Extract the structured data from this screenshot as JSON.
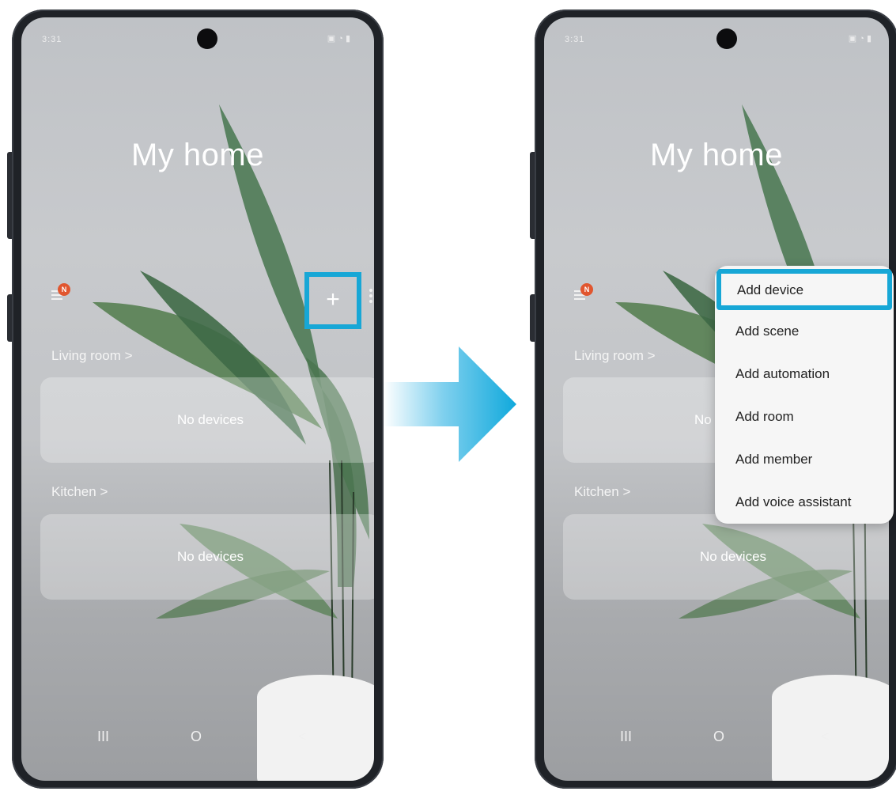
{
  "left_screen": {
    "status_time": "3:31",
    "title": "My home",
    "notification_badge": "N",
    "add_button_label": "+",
    "rooms": [
      {
        "name": "Living room",
        "empty_text": "No devices"
      },
      {
        "name": "Kitchen",
        "empty_text": "No devices"
      }
    ],
    "nav": {
      "recents": "III",
      "home": "O",
      "back": "<"
    }
  },
  "right_screen": {
    "status_time": "3:31",
    "title": "My home",
    "notification_badge": "N",
    "rooms": [
      {
        "name": "Living room",
        "empty_text": "No d"
      },
      {
        "name": "Kitchen",
        "empty_text": "No devices"
      }
    ],
    "nav": {
      "recents": "III",
      "home": "O",
      "back": "<"
    },
    "menu": {
      "items": [
        {
          "label": "Add device"
        },
        {
          "label": "Add scene"
        },
        {
          "label": "Add automation"
        },
        {
          "label": "Add room"
        },
        {
          "label": "Add member"
        },
        {
          "label": "Add voice assistant"
        }
      ]
    }
  },
  "colors": {
    "highlight": "#17a7d6",
    "badge": "#e1562f",
    "arrow": "#10a9dc",
    "leaf": "#4e7a55"
  },
  "icons": [
    "menu-icon",
    "more-options-icon",
    "add-icon",
    "chevron-right-icon",
    "recents-icon",
    "home-icon",
    "back-icon",
    "transition-arrow-icon"
  ]
}
